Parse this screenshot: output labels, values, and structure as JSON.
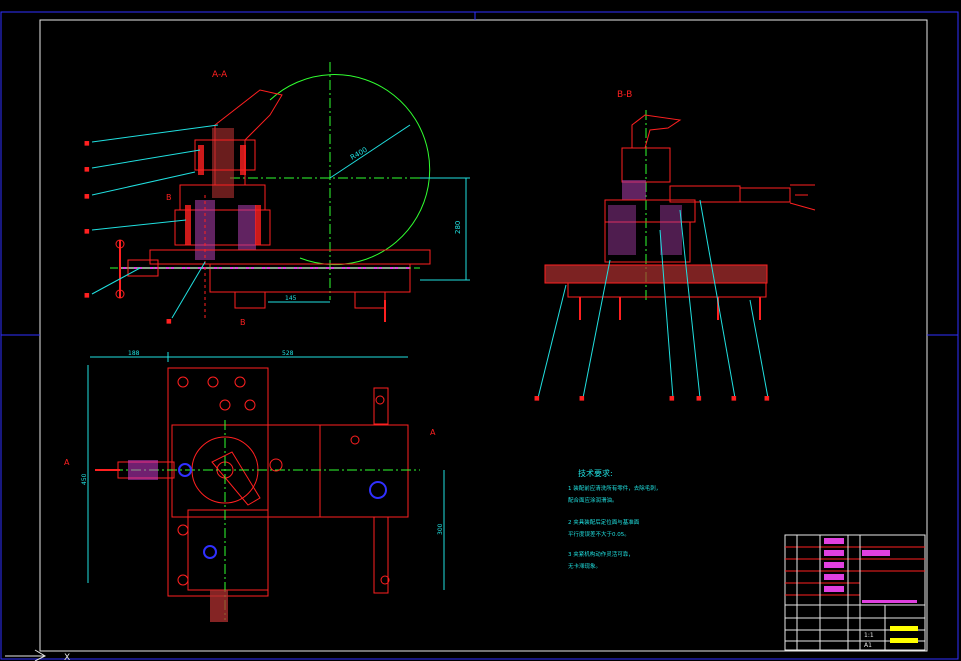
{
  "views": {
    "section_aa": {
      "label": "A-A",
      "dim_vertical": "280",
      "dim_radius": "R400",
      "dim_horizontal": "145"
    },
    "section_bb": {
      "label": "B-B"
    },
    "plan_view": {
      "dim_left": "188",
      "dim_top": "528",
      "dim_height": "450",
      "dim_right_height": "300"
    }
  },
  "section_marks": {
    "a_left": "A",
    "a_right": "A",
    "b_top": "B",
    "b_bottom": "B"
  },
  "tech_requirements": {
    "title": "技术要求:",
    "items": [
      "1  装配前应清洗所有零件，去除毛刺，",
      "   配合面应涂润滑油。",
      "2  夹具装配后定位面与基准面",
      "   平行度误差不大于0.05。",
      "3  夹紧机构动作灵活可靠，",
      "   无卡滞现象。"
    ]
  },
  "title_block": {
    "drawing_no": "A1",
    "scale": "1:1"
  },
  "colors": {
    "frame": "#3030ff",
    "part": "#ff2020",
    "dim": "#20e0e0",
    "hatch": "#e040e0",
    "center": "#30ff30",
    "hole": "#ffff00"
  }
}
